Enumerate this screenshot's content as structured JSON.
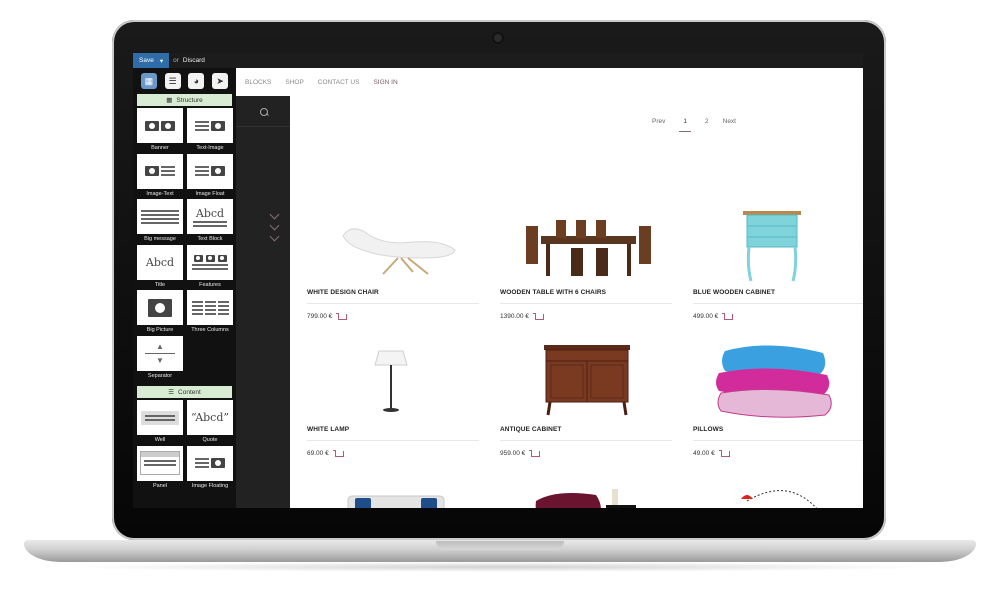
{
  "editor": {
    "save_label": "Save",
    "save_caret": "▾",
    "or_label": "or",
    "discard_label": "Discard"
  },
  "panel": {
    "sections": [
      {
        "title": "Structure",
        "blocks": [
          "Banner",
          "Text-Image",
          "Image-Text",
          "Image Float",
          "Big message",
          "Text Block",
          "Title",
          "Features",
          "Big Picture",
          "Three Columns",
          "Separator"
        ]
      },
      {
        "title": "Content",
        "blocks": [
          "Well",
          "Quote",
          "Panel",
          "Image Floating"
        ]
      }
    ],
    "abcd_text": "Abcd",
    "quote_text": "“Abcd”"
  },
  "nav": {
    "items": [
      "BLOCKS",
      "SHOP",
      "CONTACT US",
      "SIGN IN"
    ]
  },
  "pager": {
    "prev": "Prev",
    "pages": [
      "1",
      "2"
    ],
    "next": "Next"
  },
  "products": [
    {
      "name": "WHITE DESIGN CHAIR",
      "price": "799.00 €"
    },
    {
      "name": "WOODEN TABLE WITH 6 CHAIRS",
      "price": "1390.00 €"
    },
    {
      "name": "BLUE WOODEN CABINET",
      "price": "499.00 €"
    },
    {
      "name": "WHITE LAMP",
      "price": "69.00 €"
    },
    {
      "name": "ANTIQUE CABINET",
      "price": "959.00 €"
    },
    {
      "name": "PILLOWS",
      "price": "49.00 €"
    }
  ],
  "colors": {
    "save_blue": "#2f6da8",
    "accent_mauve": "#8a6a78",
    "section_green": "#d8ecd3"
  }
}
